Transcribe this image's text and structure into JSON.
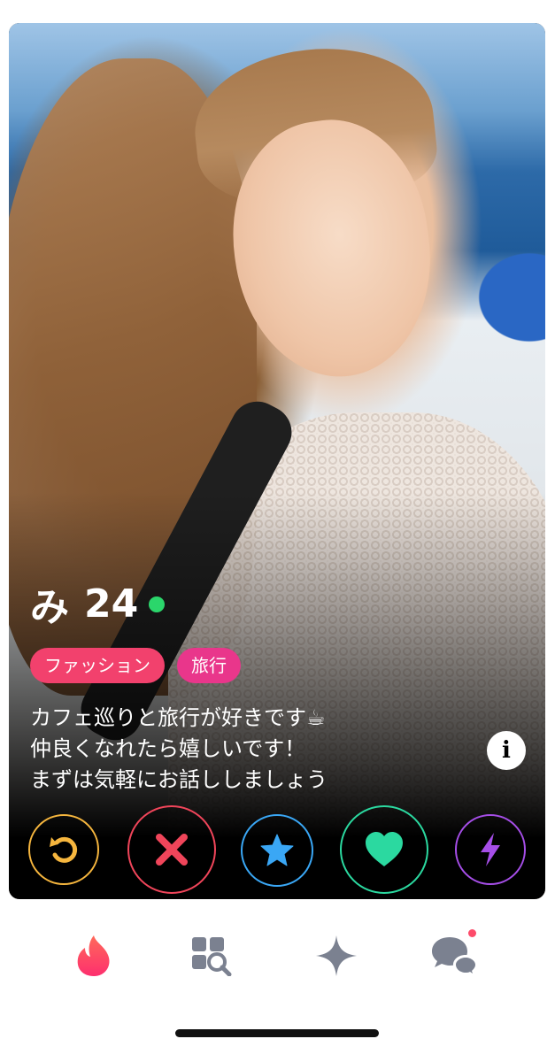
{
  "profile": {
    "name": "み",
    "age": "24",
    "online_color": "#2bd66b",
    "tags": [
      {
        "label": "ファッション",
        "color": "#f2416d"
      },
      {
        "label": "旅行",
        "color": "#e9368b"
      }
    ],
    "bio": "カフェ巡りと旅行が好きです☕\n仲良くなれたら嬉しいです！\nまずは気軽にお話ししましょう",
    "info_icon": "i"
  },
  "actions": [
    {
      "name": "rewind",
      "icon": "rewind-icon",
      "color": "#f6b63e"
    },
    {
      "name": "nope",
      "icon": "close-icon",
      "color": "#f0455a"
    },
    {
      "name": "super-like",
      "icon": "star-icon",
      "color": "#3aa7f5"
    },
    {
      "name": "like",
      "icon": "heart-icon",
      "color": "#2bd9a0"
    },
    {
      "name": "boost",
      "icon": "bolt-icon",
      "color": "#a64ee8"
    }
  ],
  "tabbar": {
    "active_color": "#fd4b6a",
    "inactive_color": "#7b8190",
    "items": [
      {
        "name": "home",
        "icon": "flame-icon",
        "active": true
      },
      {
        "name": "explore",
        "icon": "explore-grid-icon",
        "active": false
      },
      {
        "name": "matches",
        "icon": "sparkle-icon",
        "active": false
      },
      {
        "name": "chat",
        "icon": "chat-bubbles-icon",
        "active": false,
        "badge": true
      }
    ],
    "badge_color": "#fd4b6a"
  }
}
